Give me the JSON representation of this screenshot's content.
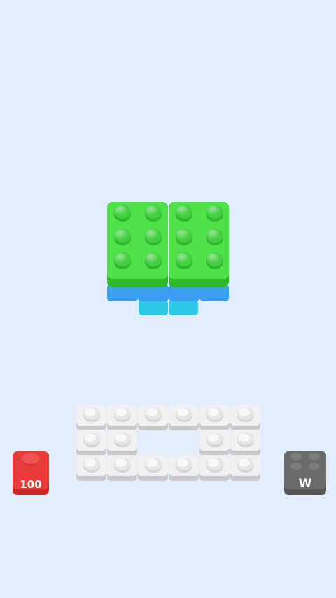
{
  "colors": {
    "background": "#e2eefc",
    "active_top": "#4fe04a",
    "active_side": "#2fb82c",
    "active_stud": "#43cf3f",
    "layer_blue": "#3a9ff0",
    "layer_cyan": "#2cc8e6",
    "board_brick": "#f1f1f1",
    "board_shadow": "#c9c9c9",
    "coin_brick": "#ea3b3b",
    "mode_brick": "#6b6b6b"
  },
  "hud": {
    "coin_value": "100",
    "mode_label": "W"
  },
  "board": {
    "columns": 6,
    "rows": 3,
    "cells": [
      [
        1,
        1,
        1,
        1,
        1,
        1
      ],
      [
        1,
        1,
        0,
        0,
        1,
        1
      ],
      [
        1,
        1,
        1,
        1,
        1,
        1
      ]
    ]
  },
  "active_piece": {
    "halves": 2,
    "studs_per_half": [
      2,
      3
    ]
  }
}
